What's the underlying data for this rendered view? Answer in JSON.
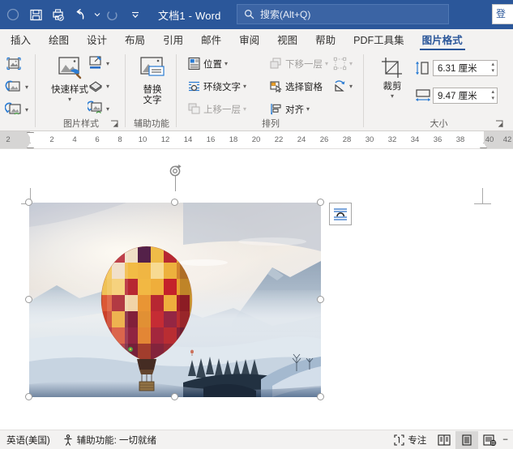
{
  "titlebar": {
    "document_name": "文档1  -  Word",
    "quick_access": [
      {
        "name": "autosave-toggle-icon",
        "label": "自动保存"
      },
      {
        "name": "save-icon",
        "label": "保存"
      },
      {
        "name": "print-preview-icon",
        "label": "打印预览和打印"
      },
      {
        "name": "undo-icon",
        "label": "撤消"
      },
      {
        "name": "redo-icon",
        "label": "恢复"
      },
      {
        "name": "customize-qat-icon",
        "label": "自定义快速访问工具栏"
      }
    ],
    "search_placeholder": "搜索(Alt+Q)",
    "search_icon": "search-icon",
    "accent_color": "#2b579a",
    "right_stub_text": "登"
  },
  "tabs": [
    {
      "label": "插入",
      "active": false
    },
    {
      "label": "绘图",
      "active": false
    },
    {
      "label": "设计",
      "active": false
    },
    {
      "label": "布局",
      "active": false
    },
    {
      "label": "引用",
      "active": false
    },
    {
      "label": "邮件",
      "active": false
    },
    {
      "label": "审阅",
      "active": false
    },
    {
      "label": "视图",
      "active": false
    },
    {
      "label": "帮助",
      "active": false
    },
    {
      "label": "PDF工具集",
      "active": false
    },
    {
      "label": "图片格式",
      "active": true
    }
  ],
  "ribbon": {
    "groups": [
      {
        "name": "adjust",
        "label": "",
        "items": [
          {
            "label": "",
            "icon": "remove-background-icon"
          },
          {
            "label": "",
            "icon": "corrections-icon"
          },
          {
            "label": "",
            "icon": "color-icon"
          }
        ]
      },
      {
        "name": "picture-styles",
        "label": "图片样式",
        "items": [
          {
            "label": "快速样式",
            "icon": "quick-styles-icon"
          },
          {
            "label": "",
            "icon": "picture-border-icon"
          },
          {
            "label": "",
            "icon": "picture-effects-icon"
          },
          {
            "label": "",
            "icon": "picture-layout-icon"
          }
        ]
      },
      {
        "name": "accessibility",
        "label": "辅助功能",
        "items": [
          {
            "label": "替换\n文字",
            "icon": "alt-text-icon"
          }
        ]
      },
      {
        "name": "arrange",
        "label": "排列",
        "items": [
          {
            "label": "位置",
            "icon": "position-icon",
            "disabled": false
          },
          {
            "label": "环绕文字",
            "icon": "wrap-text-icon",
            "disabled": false
          },
          {
            "label": "上移一层",
            "icon": "bring-forward-icon",
            "disabled": true
          },
          {
            "label": "下移一层",
            "icon": "send-backward-icon",
            "disabled": true
          },
          {
            "label": "选择窗格",
            "icon": "selection-pane-icon",
            "disabled": false
          },
          {
            "label": "对齐",
            "icon": "align-icon",
            "disabled": false
          },
          {
            "label": "",
            "icon": "group-objects-icon",
            "disabled": true
          },
          {
            "label": "",
            "icon": "rotate-objects-icon",
            "disabled": false
          }
        ]
      },
      {
        "name": "size",
        "label": "大小",
        "items": [
          {
            "label": "裁剪",
            "icon": "crop-icon"
          }
        ],
        "height_label": "6.31 厘米",
        "width_label": "9.47 厘米",
        "height_icon": "shape-height-icon",
        "width_icon": "shape-width-icon"
      }
    ]
  },
  "ruler": {
    "left_margin_label": "2",
    "ticks": [
      "2",
      "4",
      "6",
      "8",
      "10",
      "12",
      "14",
      "16",
      "18",
      "20",
      "22",
      "24",
      "26",
      "28",
      "30",
      "32",
      "34",
      "36",
      "38",
      "40",
      "42"
    ]
  },
  "document": {
    "picture": {
      "name": "hot-air-balloon-photo",
      "alt": "雪山上空的热气球",
      "selected": true,
      "rotate_handle": "rotation-handle",
      "layout_options_button": "layout-options-icon"
    }
  },
  "statusbar": {
    "language": "英语(美国)",
    "accessibility_icon": "accessibility-icon",
    "accessibility": "辅助功能: 一切就绪",
    "focus_icon": "focus-icon",
    "focus": "专注",
    "views": [
      {
        "name": "read-mode-view-button",
        "active": false
      },
      {
        "name": "print-layout-view-button",
        "active": true
      },
      {
        "name": "web-layout-view-button",
        "active": false
      }
    ],
    "zoom_out_label": "−"
  }
}
